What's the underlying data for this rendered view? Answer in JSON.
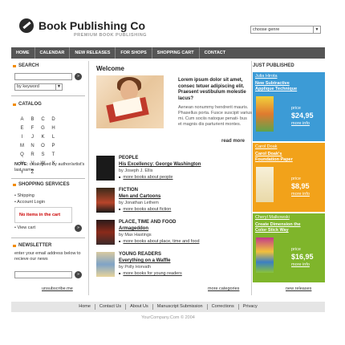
{
  "header": {
    "title": "Book Publishing Co",
    "subtitle": "PREMIUM BOOK PUBLISHING",
    "genre_select": "choose genre"
  },
  "nav": [
    "HOME",
    "CALENDAR",
    "NEW RELEASES",
    "FOR SHOPS",
    "SHOPPING CART",
    "CONTACT"
  ],
  "search": {
    "title": "SEARCH",
    "go": "»",
    "by": "by keyword"
  },
  "catalog": {
    "title": "CATALOG",
    "letters": [
      "A",
      "B",
      "C",
      "D",
      "E",
      "F",
      "G",
      "H",
      "I",
      "J",
      "K",
      "L",
      "M",
      "N",
      "O",
      "P",
      "Q",
      "R",
      "S",
      "T",
      "U",
      "V",
      "W",
      "X",
      "Y",
      "Z"
    ],
    "note_label": "NOTE:",
    "note_text": "catalogued by author/artist's last name"
  },
  "shopping": {
    "title": "SHOPPING SERVICES",
    "links": [
      "• Shipping",
      "• Account Login"
    ],
    "cart_empty": "No items in the cart",
    "view_cart": "• View cart"
  },
  "newsletter": {
    "title": "NEWSLETTER",
    "text": "enter your email address below to recieve our news",
    "unsubscribe": "unsubscribe me"
  },
  "welcome": {
    "title": "Welcome",
    "bold": "Lorem ipsum dolor sit amet, consec tetuer adipiscing elit. Praesent vestibulum molestie lacus?",
    "text": "Aenean nonummy hendrerit mauris. Phasellus porta. Fusce suscipit varius mi. Cum sociis natoque penati- bus et magnis dis parturient montes.",
    "readmore": "read more"
  },
  "categories": [
    {
      "title": "PEOPLE",
      "book": "His Excellency: George Washington",
      "author": "by Joseph J. Ellis",
      "more": "more books about people"
    },
    {
      "title": "FICTION",
      "book": "Men and Cartoons",
      "author": "by Jonathan Lethem",
      "more": "more books about fiction"
    },
    {
      "title": "PLACE, TIME AND FOOD",
      "book": "Armageddon",
      "author": "by Max Hastings",
      "more": "more books about place, time and food"
    },
    {
      "title": "YOUNG READERS",
      "book": "Everything on a Waffle",
      "author": "by Polly Horvath",
      "more": "more books for young readers"
    }
  ],
  "more_categories": "more categories",
  "just_published": {
    "title": "JUST PUBLISHED",
    "items": [
      {
        "author": "Julia Hirota",
        "book": "New Subtractive Applique Technique",
        "price_label": "price",
        "price": "$24,95",
        "more": "more info",
        "color": "#3c9bd6"
      },
      {
        "author": "Carol Doak",
        "book": "Carol Doak's Foundation Paper",
        "price_label": "price",
        "price": "$8,95",
        "more": "more info",
        "color": "#f2a21a"
      },
      {
        "author": "Cheryl Malkowski",
        "book": "Create Dimension the Color Stick Way",
        "price_label": "price",
        "price": "$16,95",
        "more": "more info",
        "color": "#7fb52b"
      }
    ],
    "new_releases": "new releases"
  },
  "footer": {
    "links": [
      "Home",
      "Contact Us",
      "About Us",
      "Manuscript Submission",
      "Corrections",
      "Privacy"
    ],
    "copyright": "YourCompany.Com © 2004"
  }
}
